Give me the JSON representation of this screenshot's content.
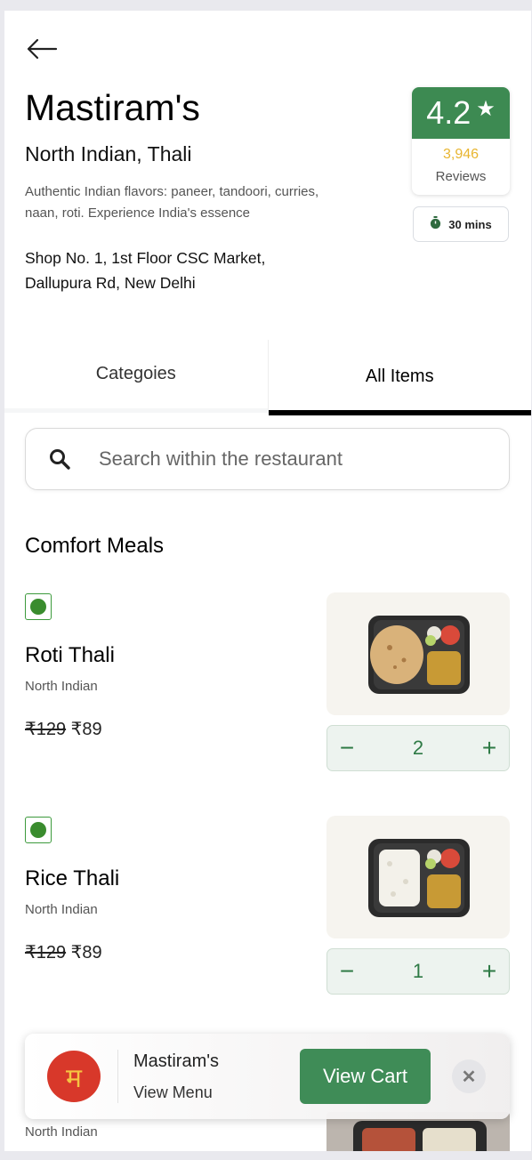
{
  "restaurant": {
    "name": "Mastiram's",
    "cuisine": "North Indian, Thali",
    "description": "Authentic Indian flavors: paneer, tandoori, curries, naan, roti. Experience India's essence",
    "address": "Shop No. 1, 1st Floor CSC Market, Dallupura Rd, New Delhi"
  },
  "rating": {
    "value": "4.2",
    "count": "3,946",
    "label": "Reviews",
    "star_icon": "star-icon",
    "colors": {
      "badge": "#3d8a52",
      "count": "#e8b530"
    }
  },
  "delivery": {
    "time": "30 mins",
    "icon": "timer-icon"
  },
  "tabs": [
    {
      "label": "Categoies",
      "active": false
    },
    {
      "label": "All Items",
      "active": true
    }
  ],
  "search": {
    "placeholder": "Search within the restaurant",
    "value": ""
  },
  "section": {
    "title": "Comfort Meals"
  },
  "items": [
    {
      "name": "Roti Thali",
      "cuisine": "North Indian",
      "old_price": "₹129",
      "price": "₹89",
      "quantity": "2",
      "veg": true
    },
    {
      "name": "Rice Thali",
      "cuisine": "North Indian",
      "old_price": "₹129",
      "price": "₹89",
      "quantity": "1",
      "veg": true
    }
  ],
  "peek_item": {
    "cuisine": "North Indian"
  },
  "stepper": {
    "minus": "−",
    "plus": "+"
  },
  "cart_bar": {
    "logo_text": "म",
    "name": "Mastiram's",
    "view_menu": "View Menu",
    "view_cart": "View Cart",
    "close": "✕",
    "accent": "#3f8c57"
  }
}
